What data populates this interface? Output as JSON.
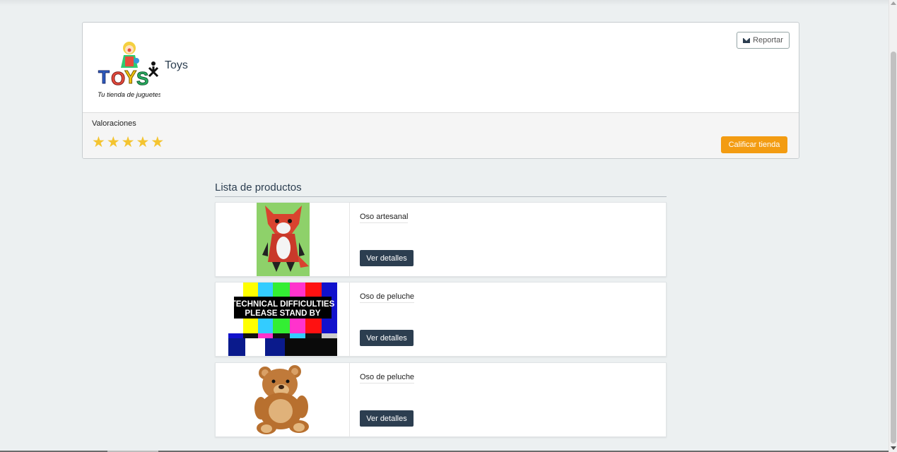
{
  "store": {
    "name": "Toys",
    "logo_text": "TOYS",
    "logo_tagline": "Tu tienda de juguetes",
    "report_label": "Reportar",
    "ratings_label": "Valoraciones",
    "rating": 5,
    "rate_button_label": "Calificar tienda"
  },
  "products_section": {
    "title": "Lista de productos",
    "items": [
      {
        "name": "Oso artesanal",
        "button_label": "Ver detalles",
        "image": "fox-plush"
      },
      {
        "name": "Oso de peluche",
        "button_label": "Ver detalles",
        "image": "technical-difficulties"
      },
      {
        "name": "Oso de peluche",
        "button_label": "Ver detalles",
        "image": "teddy-bear"
      }
    ],
    "tv_text_line1": "TECHNICAL DIFFICULTIES",
    "tv_text_line2": "PLEASE STAND BY"
  },
  "colors": {
    "accent": "#f39c12",
    "primary_dark": "#2c3e50",
    "background": "#ecf0f1",
    "star": "#f4c430"
  }
}
